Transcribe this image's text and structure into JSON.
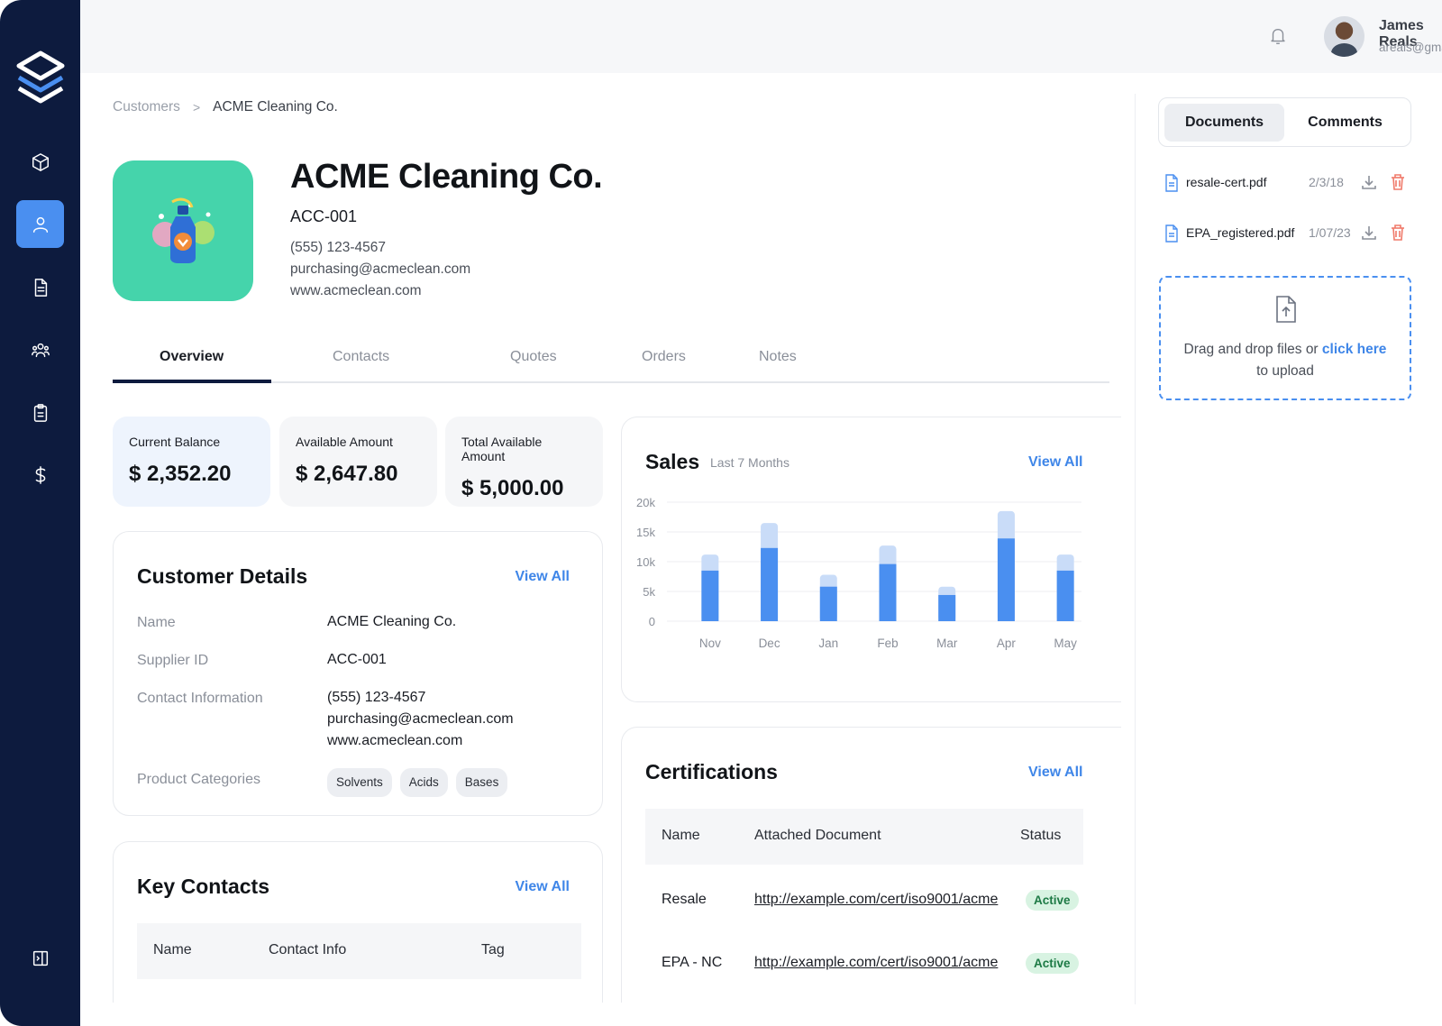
{
  "user": {
    "name": "James Reals",
    "email": "areals@gmail.com"
  },
  "breadcrumb": {
    "parent": "Customers",
    "separator": ">",
    "current": "ACME Cleaning Co."
  },
  "company": {
    "name": "ACME Cleaning Co.",
    "id": "ACC-001",
    "phone": "(555) 123-4567",
    "email": "purchasing@acmeclean.com",
    "website": "www.acmeclean.com"
  },
  "tabs": [
    {
      "label": "Overview"
    },
    {
      "label": "Contacts"
    },
    {
      "label": "Quotes"
    },
    {
      "label": "Orders"
    },
    {
      "label": "Notes"
    }
  ],
  "stats": [
    {
      "label": "Current Balance",
      "value": "$ 2,352.20"
    },
    {
      "label": "Available Amount",
      "value": "$ 2,647.80"
    },
    {
      "label": "Total Available Amount",
      "value": "$ 5,000.00"
    }
  ],
  "customer_details": {
    "title": "Customer Details",
    "view_all": "View All",
    "labels": {
      "name": "Name",
      "supplier_id": "Supplier ID",
      "contact": "Contact Information",
      "categories": "Product Categories"
    },
    "name": "ACME Cleaning Co.",
    "supplier_id": "ACC-001",
    "phone": "(555) 123-4567",
    "email": "purchasing@acmeclean.com",
    "website": "www.acmeclean.com",
    "categories": [
      "Solvents",
      "Acids",
      "Bases"
    ]
  },
  "key_contacts": {
    "title": "Key Contacts",
    "view_all": "View All",
    "columns": [
      "Name",
      "Contact Info",
      "Tag"
    ]
  },
  "sales": {
    "title": "Sales",
    "subtitle": "Last 7 Months",
    "view_all": "View All"
  },
  "chart_data": {
    "type": "bar",
    "categories": [
      "Nov",
      "Dec",
      "Jan",
      "Feb",
      "Mar",
      "Apr",
      "May"
    ],
    "series": [
      {
        "values": [
          8500,
          12300,
          5800,
          9600,
          4400,
          13900,
          8500
        ]
      },
      {
        "values": [
          11200,
          16500,
          7800,
          12700,
          5800,
          18500,
          11200
        ]
      }
    ],
    "y_ticks": [
      "20k",
      "15k",
      "10k",
      "5k",
      "0"
    ],
    "ylim": [
      0,
      20000
    ],
    "colors": {
      "primary": "#4a8ff0",
      "secondary": "#c9dcf8"
    },
    "grid": true
  },
  "certifications": {
    "title": "Certifications",
    "view_all": "View All",
    "columns": [
      "Name",
      "Attached Document",
      "Status"
    ],
    "rows": [
      {
        "name": "Resale",
        "document": "http://example.com/cert/iso9001/acme",
        "status": "Active"
      },
      {
        "name": "EPA - NC",
        "document": "http://example.com/cert/iso9001/acme",
        "status": "Active"
      }
    ]
  },
  "right_panel": {
    "tabs": [
      "Documents",
      "Comments"
    ],
    "documents": [
      {
        "name": "resale-cert.pdf",
        "date": "2/3/18"
      },
      {
        "name": "EPA_registered.pdf",
        "date": "1/07/23"
      }
    ],
    "dropzone": {
      "text_before": "Drag and drop files or ",
      "link": "click here",
      "text_after": "to upload"
    }
  },
  "colors": {
    "sidebar": "#0d1b3e",
    "accent": "#4a8ff0",
    "logo_bg": "#45d4ab",
    "active_badge": "#d8f3e2"
  }
}
